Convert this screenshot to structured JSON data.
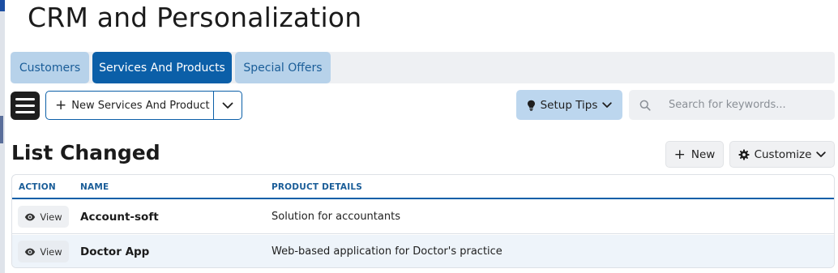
{
  "page": {
    "title": "CRM and Personalization"
  },
  "tabs": [
    {
      "label": "Customers",
      "active": false
    },
    {
      "label": "Services And Products",
      "active": true
    },
    {
      "label": "Special Offers",
      "active": false
    }
  ],
  "toolbar": {
    "menu_icon": "hamburger-icon",
    "new_button_label": "New Services And Product",
    "setup_tips_label": "Setup Tips",
    "search_placeholder": "Search for keywords..."
  },
  "list": {
    "title": "List Changed",
    "new_label": "New",
    "customize_label": "Customize",
    "columns": [
      "ACTION",
      "NAME",
      "PRODUCT DETAILS"
    ],
    "rows": [
      {
        "action": "View",
        "name": "Account-soft",
        "details": "Solution for accountants"
      },
      {
        "action": "View",
        "name": "Doctor App",
        "details": "Web-based application for Doctor's practice"
      }
    ]
  },
  "colors": {
    "primary": "#0b5fa8",
    "tab_inactive": "#b7d2ea",
    "setup_tips_bg": "#bcd6ee",
    "row_alt": "#eef4fa"
  }
}
